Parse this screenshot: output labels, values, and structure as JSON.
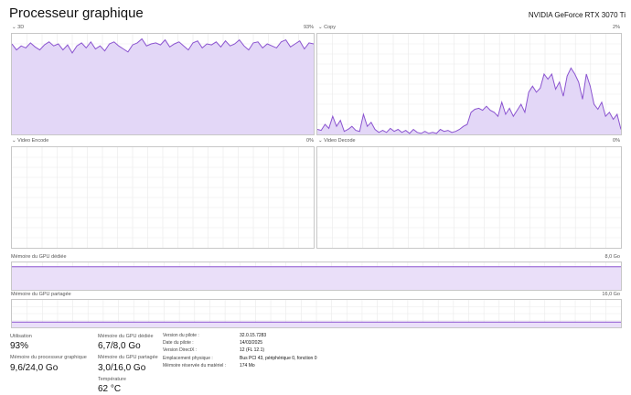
{
  "header": {
    "title": "Processeur graphique",
    "gpu_name": "NVIDIA GeForce RTX 3070 Ti"
  },
  "engines": [
    {
      "name": "3D",
      "max_label": "93%",
      "values": [
        90,
        84,
        88,
        86,
        91,
        87,
        84,
        89,
        92,
        88,
        90,
        84,
        89,
        81,
        88,
        91,
        86,
        92,
        85,
        88,
        83,
        90,
        92,
        88,
        85,
        82,
        89,
        91,
        95,
        88,
        90,
        91,
        89,
        94,
        87,
        90,
        92,
        88,
        84,
        91,
        93,
        86,
        90,
        89,
        92,
        87,
        93,
        88,
        90,
        94,
        88,
        84,
        91,
        92,
        86,
        90,
        88,
        86,
        92,
        94,
        87,
        90,
        93,
        85,
        91,
        90
      ]
    },
    {
      "name": "Copy",
      "max_label": "2%",
      "values": [
        0.05,
        0.04,
        0.1,
        0.06,
        0.18,
        0.08,
        0.14,
        0.03,
        0.05,
        0.08,
        0.04,
        0.03,
        0.2,
        0.08,
        0.12,
        0.05,
        0.02,
        0.04,
        0.02,
        0.06,
        0.03,
        0.05,
        0.02,
        0.04,
        0.01,
        0.05,
        0.02,
        0.01,
        0.03,
        0.01,
        0.02,
        0.01,
        0.05,
        0.03,
        0.04,
        0.02,
        0.03,
        0.05,
        0.08,
        0.1,
        0.22,
        0.25,
        0.26,
        0.24,
        0.28,
        0.24,
        0.22,
        0.18,
        0.32,
        0.2,
        0.26,
        0.18,
        0.24,
        0.3,
        0.22,
        0.42,
        0.48,
        0.42,
        0.46,
        0.6,
        0.55,
        0.6,
        0.45,
        0.52,
        0.38,
        0.58,
        0.66,
        0.6,
        0.52,
        0.35,
        0.6,
        0.48,
        0.3,
        0.25,
        0.32,
        0.18,
        0.22,
        0.15,
        0.2,
        0.05
      ]
    },
    {
      "name": "Video Encode",
      "max_label": "0%",
      "values": []
    },
    {
      "name": "Video Decode",
      "max_label": "0%",
      "values": []
    }
  ],
  "memory": {
    "dedicated": {
      "label": "Mémoire du GPU dédiée",
      "max_label": "8,0 Go",
      "level": 0.84
    },
    "shared": {
      "label": "Mémoire du GPU partagée",
      "max_label": "16,0 Go",
      "level": 0.19
    }
  },
  "stats": {
    "utilization_label": "Utilisation",
    "utilization_value": "93%",
    "gpu_memory_label": "Mémoire du processeur graphique",
    "gpu_memory_value": "9,6/24,0 Go",
    "dedicated_label": "Mémoire du GPU dédiée",
    "dedicated_value": "6,7/8,0 Go",
    "shared_label": "Mémoire du GPU partagée",
    "shared_value": "3,0/16,0 Go",
    "temperature_label": "Température",
    "temperature_value": "62 °C"
  },
  "info": [
    {
      "key": "Version du pilote :",
      "value": "32.0.15.7283"
    },
    {
      "key": "Date du pilote :",
      "value": "14/03/2025"
    },
    {
      "key": "Version DirectX :",
      "value": "12 (FL 12.1)"
    },
    {
      "key": "Emplacement physique :",
      "value": "Bus PCI 43, périphérique 0, fonction 0"
    },
    {
      "key": "Mémoire réservée du matériel :",
      "value": "174 Mo"
    }
  ],
  "colors": {
    "grid": "#eaeaea",
    "fill": "#e3d7f7",
    "line": "#8b54d0",
    "memfill": "#eadff9"
  }
}
